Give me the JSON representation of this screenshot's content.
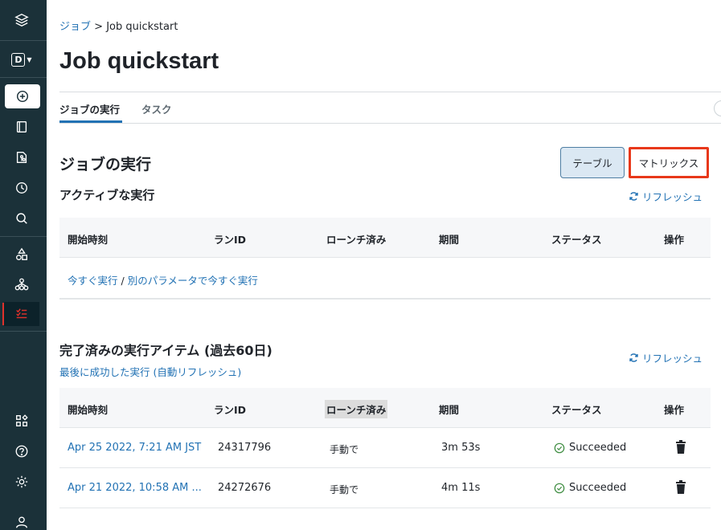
{
  "sidebar": {
    "items": [
      {
        "name": "layers-icon"
      },
      {
        "name": "workspace-switcher",
        "label": "D"
      },
      {
        "name": "create-icon"
      },
      {
        "name": "notebook-icon"
      },
      {
        "name": "repos-icon"
      },
      {
        "name": "history-icon"
      },
      {
        "name": "search-icon"
      },
      {
        "name": "shapes-icon"
      },
      {
        "name": "cluster-icon"
      },
      {
        "name": "jobs-icon"
      },
      {
        "name": "marketplace-icon"
      },
      {
        "name": "help-icon"
      },
      {
        "name": "settings-icon"
      },
      {
        "name": "user-icon"
      }
    ],
    "active_color": "#e0312b"
  },
  "breadcrumb": {
    "parent": "ジョブ",
    "separator": ">",
    "current": "Job quickstart"
  },
  "page": {
    "title": "Job quickstart"
  },
  "tabs": [
    {
      "label": "ジョブの実行",
      "active": true
    },
    {
      "label": "タスク",
      "active": false
    }
  ],
  "runs": {
    "title": "ジョブの実行",
    "view_table": "テーブル",
    "view_matrix": "マトリックス",
    "active": {
      "title": "アクティブな実行",
      "refresh": "リフレッシュ",
      "columns": [
        "開始時刻",
        "ランID",
        "ローンチ済み",
        "期間",
        "ステータス",
        "操作"
      ],
      "run_now": "今すぐ実行",
      "divider": " / ",
      "run_with_params": "別のパラメータで今すぐ実行"
    },
    "completed": {
      "title": "完了済みの実行アイテム (過去60日)",
      "refresh": "リフレッシュ",
      "last_success": "最後に成功した実行 (自動リフレッシュ)",
      "columns": [
        "開始時刻",
        "ランID",
        "ローンチ済み",
        "期間",
        "ステータス",
        "操作"
      ],
      "rows": [
        {
          "start": "Apr 25 2022, 7:21 AM JST",
          "run_id": "24317796",
          "launched": "手動で",
          "duration": "3m 53s",
          "status": "Succeeded"
        },
        {
          "start": "Apr 21 2022, 10:58 AM ...",
          "run_id": "24272676",
          "launched": "手動で",
          "duration": "4m 11s",
          "status": "Succeeded"
        }
      ]
    }
  },
  "colors": {
    "link": "#2272b4",
    "sidebar_bg": "#1b3139",
    "success": "#3b8b3e",
    "highlight_border": "#e8381a"
  }
}
